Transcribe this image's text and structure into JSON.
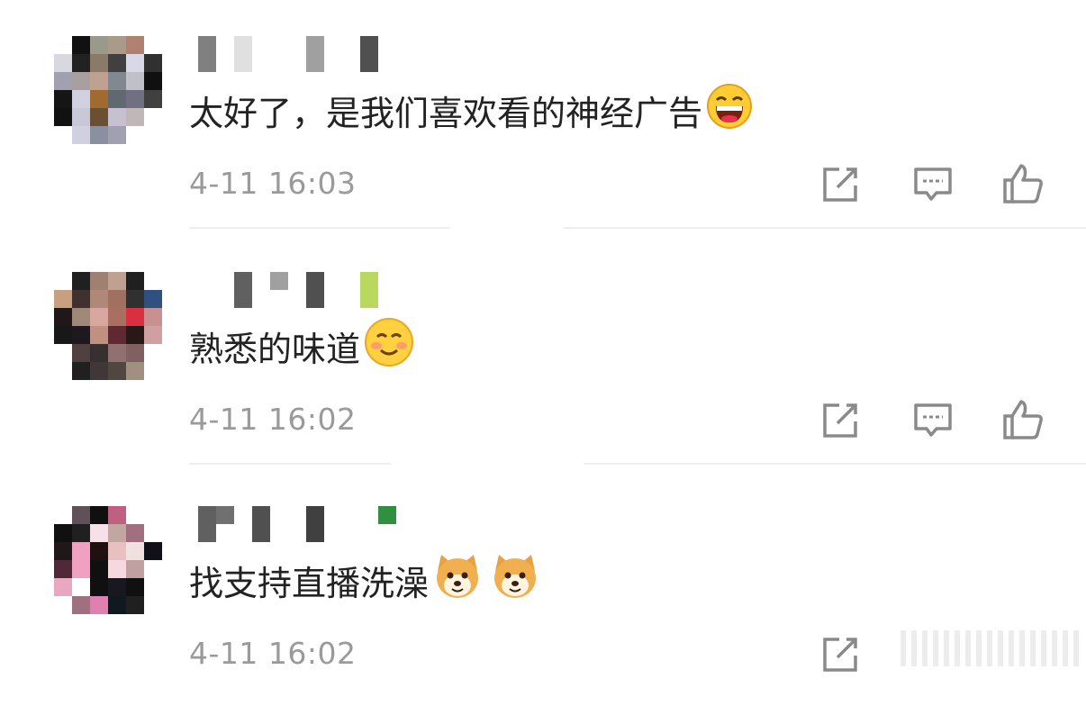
{
  "comments": [
    {
      "text": "太好了，是我们喜欢看的神经广告",
      "emoji": "grinning-laughing-emoji",
      "time": "4-11 16:03",
      "avatar_colors": [
        "#ffffff",
        "#111111",
        "#9a9a8a",
        "#aa9a8a",
        "#b08070",
        "#ffffff",
        "#d8d8e0",
        "#222222",
        "#8a7a6a",
        "#404040",
        "#d8d8e8",
        "#303030",
        "#a0a0b0",
        "#a8a0a0",
        "#c0a090",
        "#808890",
        "#c0c0c8",
        "#101010",
        "#151515",
        "#d0d0e0",
        "#a06a30",
        "#606870",
        "#707080",
        "#404040",
        "#111111",
        "#c8c8d8",
        "#6a5030",
        "#c8c0d0",
        "#c0b8b8",
        "#ffffff",
        "#ffffff",
        "#d0d0e0",
        "#8a90a0",
        "#a0a0b0",
        "#ffffff",
        "#ffffff"
      ],
      "name_colors": [
        "#808080",
        "#ffffff",
        "#e0e0e0",
        "#ffffff",
        "#ffffff",
        "#ffffff",
        "#a0a0a0",
        "#ffffff",
        "#ffffff",
        "#505050",
        "#ffffff"
      ]
    },
    {
      "text": "熟悉的味道",
      "emoji": "smiling-blush-emoji",
      "time": "4-11 16:02",
      "avatar_colors": [
        "#ffffff",
        "#202020",
        "#a08070",
        "#c0a090",
        "#202020",
        "#ffffff",
        "#c8a080",
        "#403030",
        "#b08878",
        "#a07060",
        "#303030",
        "#305080",
        "#201818",
        "#a08878",
        "#d8a8a0",
        "#a87060",
        "#d83040",
        "#c89090",
        "#181818",
        "#201820",
        "#c09080",
        "#602830",
        "#281818",
        "#d0a0a0",
        "#ffffff",
        "#504040",
        "#383030",
        "#907070",
        "#806060",
        "#ffffff",
        "#ffffff",
        "#202020",
        "#403838",
        "#504840",
        "#a09080",
        "#ffffff"
      ],
      "name_colors": [
        "#ffffff",
        "#ffffff",
        "#606060",
        "#ffffff",
        "#a0a0a0",
        "#ffffff",
        "#505050",
        "#ffffff",
        "#ffffff",
        "#b8d860",
        "#ffffff"
      ]
    },
    {
      "text": "找支持直播洗澡",
      "emoji": "shiba-dog-emoji",
      "time": "4-11 16:02",
      "avatar_colors": [
        "#ffffff",
        "#605058",
        "#101010",
        "#c06080",
        "#ffffff",
        "#ffffff",
        "#101010",
        "#202020",
        "#f8e0e8",
        "#c0a8a0",
        "#a07080",
        "#ffffff",
        "#201818",
        "#f0a0c0",
        "#201010",
        "#e8c0c0",
        "#f0e0e0",
        "#101018",
        "#502838",
        "#f0a0c0",
        "#101010",
        "#f8d8e0",
        "#c0a0a0",
        "#ffffff",
        "#e8a8c0",
        "#ffffff",
        "#101010",
        "#181820",
        "#101010",
        "#ffffff",
        "#ffffff",
        "#a07080",
        "#e080b0",
        "#101820",
        "#202020",
        "#ffffff"
      ],
      "name_colors": [
        "#606060",
        "#707070",
        "#ffffff",
        "#505050",
        "#ffffff",
        "#ffffff",
        "#404040",
        "#ffffff",
        "#ffffff",
        "#ffffff",
        "#309040"
      ]
    }
  ],
  "actions": {
    "share_icon": "share-external-icon",
    "reply_icon": "reply-comment-icon",
    "like_icon": "thumbs-up-icon"
  },
  "colors": {
    "text": "#222222",
    "time": "#9a9a9a",
    "icon": "#8a8a8a",
    "divider": "#eeeeee"
  }
}
